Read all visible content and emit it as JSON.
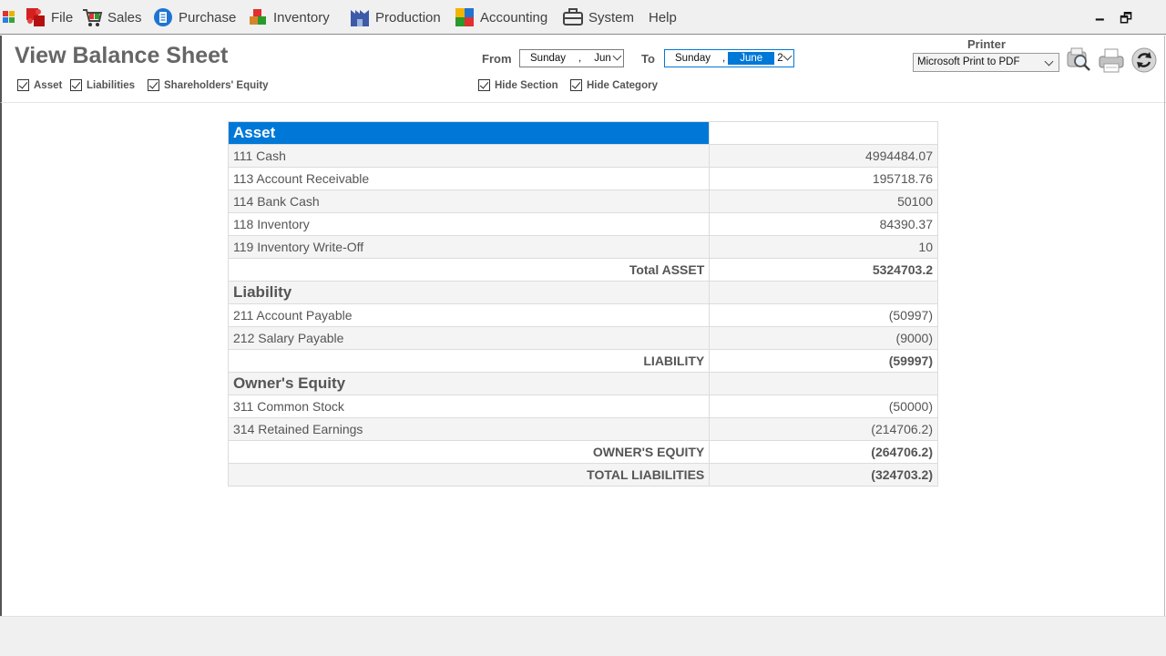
{
  "menu": {
    "items": [
      {
        "label": "File",
        "icon": "file-puzzle-icon"
      },
      {
        "label": "Sales",
        "icon": "cart-icon"
      },
      {
        "label": "Purchase",
        "icon": "purchase-icon"
      },
      {
        "label": "Inventory",
        "icon": "boxes-icon"
      },
      {
        "label": "Production",
        "icon": "factory-icon"
      },
      {
        "label": "Accounting",
        "icon": "accounting-icon"
      },
      {
        "label": "System",
        "icon": "system-icon"
      },
      {
        "label": "Help"
      }
    ],
    "minimize": "🗕",
    "restore": "🗗"
  },
  "header": {
    "title": "View Balance Sheet",
    "filters": {
      "asset": "Asset",
      "liabilities": "Liabilities",
      "equity": "Shareholders' Equity",
      "hide_section": "Hide Section",
      "hide_category": "Hide Category"
    },
    "from_label": "From",
    "to_label": "To",
    "from_date": {
      "day": "Sunday",
      "sep": ",",
      "month": "Jun"
    },
    "to_date": {
      "day": "Sunday",
      "sep": ",",
      "month": "June",
      "day_num": "2"
    },
    "printer_label": "Printer",
    "printer_value": "Microsoft Print to PDF"
  },
  "report": {
    "asset": {
      "title": "Asset",
      "rows": [
        {
          "name": "111 Cash",
          "value": "4994484.07"
        },
        {
          "name": "113 Account Receivable",
          "value": "195718.76"
        },
        {
          "name": "114 Bank Cash",
          "value": "50100"
        },
        {
          "name": "118 Inventory",
          "value": "84390.37"
        },
        {
          "name": "119 Inventory Write-Off",
          "value": "10"
        }
      ],
      "total_label": "Total ASSET",
      "total_value": "5324703.2"
    },
    "liability": {
      "title": "Liability",
      "rows": [
        {
          "name": "211 Account Payable",
          "value": "(50997)"
        },
        {
          "name": "212 Salary Payable",
          "value": "(9000)"
        }
      ],
      "total_label": "LIABILITY",
      "total_value": "(59997)"
    },
    "equity": {
      "title": "Owner's Equity",
      "rows": [
        {
          "name": "311 Common Stock",
          "value": "(50000)"
        },
        {
          "name": "314 Retained Earnings",
          "value": "(214706.2)"
        }
      ],
      "total_label": "OWNER'S EQUITY",
      "total_value": "(264706.2)"
    },
    "grand_total_label": "TOTAL LIABILITIES",
    "grand_total_value": "(324703.2)"
  },
  "colors": {
    "accent": "#0078d7",
    "alt_row": "#f4f4f4",
    "text": "#555555"
  }
}
